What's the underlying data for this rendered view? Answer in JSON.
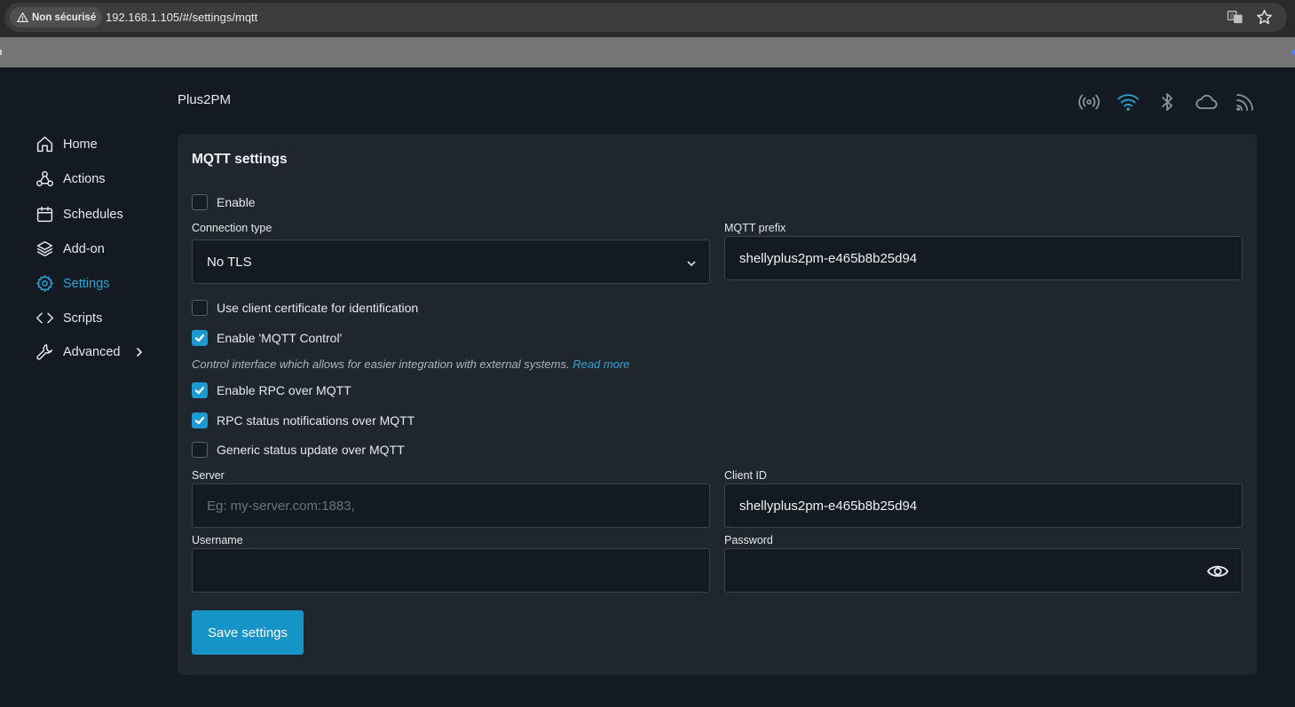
{
  "browser": {
    "security_label": "Non sécurisé",
    "url": "192.168.1.105/#/settings/mqtt",
    "icons": [
      "warning-icon",
      "translate-icon",
      "star-icon"
    ]
  },
  "device_name": "Plus2PM",
  "status_icons": [
    "broadcast-icon",
    "wifi-icon",
    "bluetooth-icon",
    "cloud-icon",
    "rss-icon"
  ],
  "sidebar": {
    "items": [
      {
        "label": "Home",
        "icon": "home-icon"
      },
      {
        "label": "Actions",
        "icon": "webhook-icon"
      },
      {
        "label": "Schedules",
        "icon": "calendar-icon"
      },
      {
        "label": "Add-on",
        "icon": "layers-icon"
      },
      {
        "label": "Settings",
        "icon": "gear-icon",
        "active": true
      },
      {
        "label": "Scripts",
        "icon": "code-icon"
      },
      {
        "label": "Advanced",
        "icon": "wrench-icon",
        "has_submenu": true
      }
    ]
  },
  "mqtt": {
    "title": "MQTT settings",
    "enable_label": "Enable",
    "enable_checked": false,
    "connection_type_label": "Connection type",
    "connection_type_value": "No TLS",
    "prefix_label": "MQTT prefix",
    "prefix_value": "shellyplus2pm-e465b8b25d94",
    "client_cert_label": "Use client certificate for identification",
    "client_cert_checked": false,
    "mqtt_control_label": "Enable 'MQTT Control'",
    "mqtt_control_checked": true,
    "hint_text": "Control interface which allows for easier integration with external systems.",
    "hint_link": "Read more",
    "rpc_label": "Enable RPC over MQTT",
    "rpc_checked": true,
    "rpc_status_label": "RPC status notifications over MQTT",
    "rpc_status_checked": true,
    "generic_status_label": "Generic status update over MQTT",
    "generic_status_checked": false,
    "server_label": "Server",
    "server_value": "",
    "server_placeholder": "Eg: my-server.com:1883,",
    "client_id_label": "Client ID",
    "client_id_value": "shellyplus2pm-e465b8b25d94",
    "username_label": "Username",
    "username_value": "",
    "password_label": "Password",
    "password_value": "",
    "save_label": "Save settings"
  },
  "colors": {
    "accent": "#1b9ad1",
    "background": "#131a21",
    "card": "#1f262d"
  }
}
